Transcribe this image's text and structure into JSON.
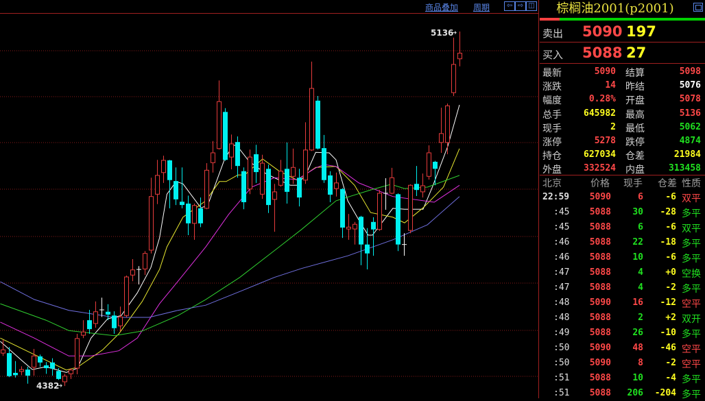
{
  "toolbar": {
    "overlay_label": "商品叠加",
    "period_label": "周期",
    "nav_left_icon": "arrow-left-icon",
    "nav_right_icon": "arrow-right-icon",
    "panel_toggle_icon": "panel-toggle-icon"
  },
  "colors": {
    "up": "#e83c3c",
    "down": "#00f0f0",
    "flat": "#ffffff",
    "grid": "#8a1a1a",
    "label_red": "#ff4848",
    "label_green": "#20e020",
    "label_yellow": "#ffff20",
    "label_white": "#ffffff"
  },
  "chart_data": {
    "type": "candlestick",
    "high_label": "5136",
    "low_label": "4382",
    "grid": true,
    "candles_ohlc": [
      [
        4452,
        4480,
        4446,
        4459
      ],
      [
        4452,
        4465,
        4401,
        4403
      ],
      [
        4410,
        4435,
        4400,
        4405
      ],
      [
        4413,
        4424,
        4405,
        4417
      ],
      [
        4417,
        4423,
        4387,
        4404
      ],
      [
        4422,
        4461,
        4404,
        4446
      ],
      [
        4445,
        4449,
        4423,
        4432
      ],
      [
        4426,
        4433,
        4408,
        4420
      ],
      [
        4432,
        4441,
        4404,
        4419
      ],
      [
        4414,
        4420,
        4395,
        4397
      ],
      [
        4391,
        4408,
        4382,
        4403
      ],
      [
        4408,
        4420,
        4397,
        4416
      ],
      [
        4420,
        4493,
        4407,
        4483
      ],
      [
        4490,
        4522,
        4484,
        4497
      ],
      [
        4522,
        4544,
        4493,
        4503
      ],
      [
        4515,
        4562,
        4506,
        4540
      ],
      [
        4544,
        4570,
        4529,
        4544
      ],
      [
        4540,
        4556,
        4522,
        4534
      ],
      [
        4532,
        4541,
        4493,
        4505
      ],
      [
        4510,
        4551,
        4499,
        4529
      ],
      [
        4532,
        4617,
        4528,
        4614
      ],
      [
        4618,
        4652,
        4605,
        4629
      ],
      [
        4630,
        4637,
        4598,
        4630
      ],
      [
        4631,
        4669,
        4618,
        4664
      ],
      [
        4671,
        4825,
        4664,
        4785
      ],
      [
        4790,
        4863,
        4769,
        4830
      ],
      [
        4836,
        4872,
        4814,
        4862
      ],
      [
        4862,
        4863,
        4760,
        4820
      ],
      [
        4818,
        4847,
        4767,
        4779
      ],
      [
        4774,
        4847,
        4760,
        4767
      ],
      [
        4770,
        4787,
        4703,
        4728
      ],
      [
        4728,
        4770,
        4693,
        4766
      ],
      [
        4760,
        4783,
        4720,
        4728
      ],
      [
        4760,
        4856,
        4758,
        4841
      ],
      [
        4857,
        4903,
        4836,
        4878
      ],
      [
        4887,
        5032,
        4885,
        4987
      ],
      [
        4965,
        4973,
        4861,
        4863
      ],
      [
        4869,
        4917,
        4843,
        4897
      ],
      [
        4901,
        4913,
        4825,
        4850
      ],
      [
        4839,
        4847,
        4758,
        4773
      ],
      [
        4801,
        4885,
        4790,
        4869
      ],
      [
        4875,
        4895,
        4814,
        4837
      ],
      [
        4790,
        4874,
        4780,
        4856
      ],
      [
        4844,
        4853,
        4750,
        4767
      ],
      [
        4779,
        4812,
        4710,
        4795
      ],
      [
        4809,
        4863,
        4806,
        4839
      ],
      [
        4844,
        4900,
        4770,
        4795
      ],
      [
        4828,
        4887,
        4812,
        4847
      ],
      [
        4825,
        4844,
        4764,
        4783
      ],
      [
        4820,
        4943,
        4812,
        4884
      ],
      [
        4884,
        5072,
        4882,
        5015
      ],
      [
        4989,
        4999,
        4885,
        4887
      ],
      [
        4888,
        4916,
        4814,
        4820
      ],
      [
        4830,
        4839,
        4773,
        4789
      ],
      [
        4802,
        4836,
        4785,
        4814
      ],
      [
        4801,
        4803,
        4697,
        4719
      ],
      [
        4716,
        4748,
        4693,
        4720
      ],
      [
        4716,
        4731,
        4683,
        4726
      ],
      [
        4742,
        4744,
        4639,
        4683
      ],
      [
        4683,
        4718,
        4630,
        4664
      ],
      [
        4731,
        4741,
        4659,
        4715
      ],
      [
        4715,
        4799,
        4712,
        4792
      ],
      [
        4792,
        4824,
        4757,
        4792
      ],
      [
        4792,
        4846,
        4790,
        4825
      ],
      [
        4790,
        4792,
        4669,
        4683
      ],
      [
        4683,
        4707,
        4659,
        4683
      ],
      [
        4713,
        4811,
        4707,
        4809
      ],
      [
        4812,
        4850,
        4786,
        4799
      ],
      [
        4795,
        4834,
        4783,
        4808
      ],
      [
        4828,
        4894,
        4821,
        4878
      ],
      [
        4859,
        4861,
        4809,
        4844
      ],
      [
        4900,
        4974,
        4878,
        4919
      ],
      [
        4900,
        4983,
        4875,
        4978
      ],
      [
        5006,
        5123,
        4999,
        5066
      ],
      [
        5078,
        5136,
        5062,
        5090
      ]
    ],
    "moving_averages": [
      {
        "color": "#ffffff",
        "points": [
          [
            -0.4,
            4477
          ],
          [
            3.2,
            4435
          ],
          [
            4.8,
            4417
          ],
          [
            7,
            4423
          ],
          [
            10.3,
            4411
          ],
          [
            12.1,
            4420
          ],
          [
            14.3,
            4484
          ],
          [
            17,
            4525
          ],
          [
            19.2,
            4532
          ],
          [
            21.8,
            4580
          ],
          [
            24,
            4634
          ],
          [
            25.4,
            4697
          ],
          [
            26.6,
            4790
          ],
          [
            28.1,
            4817
          ],
          [
            29.2,
            4812
          ],
          [
            32.1,
            4761
          ],
          [
            33.2,
            4766
          ],
          [
            35.9,
            4863
          ],
          [
            37.3,
            4894
          ],
          [
            37.9,
            4894
          ],
          [
            39.9,
            4860
          ],
          [
            42.6,
            4834
          ],
          [
            44,
            4825
          ],
          [
            46.6,
            4809
          ],
          [
            47.7,
            4809
          ],
          [
            49.2,
            4834
          ],
          [
            50.7,
            4879
          ],
          [
            52.9,
            4878
          ],
          [
            54,
            4863
          ],
          [
            55.9,
            4776
          ],
          [
            58.1,
            4726
          ],
          [
            59.2,
            4703
          ],
          [
            59.9,
            4703
          ],
          [
            62.1,
            4741
          ],
          [
            63.2,
            4760
          ],
          [
            65.1,
            4758
          ],
          [
            68.1,
            4758
          ],
          [
            69.6,
            4805
          ],
          [
            72.1,
            4892
          ],
          [
            74,
            4980
          ]
        ]
      },
      {
        "color": "#e8e830",
        "points": [
          [
            -0.4,
            4484
          ],
          [
            5.1,
            4449
          ],
          [
            10.3,
            4416
          ],
          [
            12.1,
            4422
          ],
          [
            16.2,
            4459
          ],
          [
            18.8,
            4493
          ],
          [
            22.6,
            4562
          ],
          [
            25.4,
            4630
          ],
          [
            26.6,
            4678
          ],
          [
            29.2,
            4741
          ],
          [
            32.9,
            4776
          ],
          [
            35.1,
            4817
          ],
          [
            36.2,
            4817
          ],
          [
            38.1,
            4831
          ],
          [
            39.2,
            4831
          ],
          [
            42.1,
            4865
          ],
          [
            44.8,
            4839
          ],
          [
            47.7,
            4820
          ],
          [
            50.7,
            4847
          ],
          [
            54,
            4849
          ],
          [
            57,
            4809
          ],
          [
            59.6,
            4751
          ],
          [
            63.2,
            4741
          ],
          [
            65.1,
            4729
          ],
          [
            68.1,
            4761
          ],
          [
            71.4,
            4805
          ],
          [
            74,
            4887
          ]
        ]
      },
      {
        "color": "#e030e0",
        "points": [
          [
            -0.4,
            4518
          ],
          [
            5.1,
            4484
          ],
          [
            10.7,
            4446
          ],
          [
            14.3,
            4446
          ],
          [
            18.8,
            4457
          ],
          [
            21.8,
            4484
          ],
          [
            25.4,
            4557
          ],
          [
            28.4,
            4605
          ],
          [
            32.9,
            4678
          ],
          [
            36.6,
            4747
          ],
          [
            40.3,
            4805
          ],
          [
            44,
            4825
          ],
          [
            47.7,
            4821
          ],
          [
            50.7,
            4846
          ],
          [
            52.1,
            4853
          ],
          [
            54,
            4849
          ],
          [
            57.7,
            4814
          ],
          [
            63.2,
            4785
          ],
          [
            69.9,
            4773
          ],
          [
            74,
            4809
          ]
        ]
      },
      {
        "color": "#30d030",
        "points": [
          [
            -0.4,
            4557
          ],
          [
            7,
            4522
          ],
          [
            10.7,
            4500
          ],
          [
            18.1,
            4489
          ],
          [
            22.6,
            4499
          ],
          [
            28.4,
            4532
          ],
          [
            32.9,
            4566
          ],
          [
            38.4,
            4613
          ],
          [
            44.8,
            4678
          ],
          [
            48.4,
            4715
          ],
          [
            54,
            4776
          ],
          [
            59.6,
            4799
          ],
          [
            62.9,
            4811
          ],
          [
            65.1,
            4802
          ],
          [
            68.8,
            4805
          ],
          [
            74,
            4830
          ]
        ]
      },
      {
        "color": "#7070e0",
        "points": [
          [
            -0.4,
            4604
          ],
          [
            5.1,
            4566
          ],
          [
            10.7,
            4543
          ],
          [
            18.1,
            4528
          ],
          [
            23.7,
            4528
          ],
          [
            28.4,
            4543
          ],
          [
            32.9,
            4554
          ],
          [
            38.4,
            4583
          ],
          [
            44,
            4613
          ],
          [
            48.4,
            4632
          ],
          [
            55.9,
            4659
          ],
          [
            63.2,
            4693
          ],
          [
            68.8,
            4725
          ],
          [
            74,
            4785
          ]
        ]
      }
    ]
  },
  "quote": {
    "title": "棕榈油2001(p2001)",
    "buy_ratio": 0.12,
    "ask": {
      "label": "卖出",
      "price": "5090",
      "volume": "197"
    },
    "bid": {
      "label": "买入",
      "price": "5088",
      "volume": "27"
    },
    "rows": [
      {
        "l1": "最新",
        "v1": "5090",
        "c1": "#ff4848",
        "l2": "结算",
        "v2": "5098",
        "c2": "#ff4848"
      },
      {
        "l1": "涨跌",
        "v1": "14",
        "c1": "#ff4848",
        "l2": "昨结",
        "v2": "5076",
        "c2": "#ffffff"
      },
      {
        "l1": "幅度",
        "v1": "0.28%",
        "c1": "#ff4848",
        "l2": "开盘",
        "v2": "5078",
        "c2": "#ff4848"
      },
      {
        "l1": "总手",
        "v1": "645982",
        "c1": "#ffff20",
        "l2": "最高",
        "v2": "5136",
        "c2": "#ff4848"
      },
      {
        "l1": "现手",
        "v1": "2",
        "c1": "#ffff20",
        "l2": "最低",
        "v2": "5062",
        "c2": "#20e020"
      },
      {
        "l1": "涨停",
        "v1": "5278",
        "c1": "#ff4848",
        "l2": "跌停",
        "v2": "4874",
        "c2": "#20e020"
      },
      {
        "l1": "持仓",
        "v1": "627034",
        "c1": "#ffff20",
        "l2": "仓差",
        "v2": "21984",
        "c2": "#ffff20"
      },
      {
        "l1": "外盘",
        "v1": "332524",
        "c1": "#ff4848",
        "l2": "内盘",
        "v2": "313458",
        "c2": "#20e020"
      }
    ]
  },
  "ticks": {
    "headers": [
      "北京",
      "价格",
      "现手",
      "仓差",
      "性质"
    ],
    "rows": [
      {
        "time": "22:59",
        "price": "5090",
        "qty": "6",
        "qty_color": "#ff4848",
        "diff": "-6",
        "nature": "双平",
        "nature_color": "#ff4848"
      },
      {
        "time": ":45",
        "price": "5088",
        "qty": "30",
        "qty_color": "#20e020",
        "diff": "-28",
        "nature": "多平",
        "nature_color": "#20e020"
      },
      {
        "time": ":45",
        "price": "5088",
        "qty": "6",
        "qty_color": "#20e020",
        "diff": "-6",
        "nature": "双平",
        "nature_color": "#20e020"
      },
      {
        "time": ":46",
        "price": "5088",
        "qty": "22",
        "qty_color": "#20e020",
        "diff": "-18",
        "nature": "多平",
        "nature_color": "#20e020"
      },
      {
        "time": ":46",
        "price": "5088",
        "qty": "10",
        "qty_color": "#20e020",
        "diff": "-6",
        "nature": "多平",
        "nature_color": "#20e020"
      },
      {
        "time": ":47",
        "price": "5088",
        "qty": "4",
        "qty_color": "#20e020",
        "diff": "+0",
        "nature": "空换",
        "nature_color": "#20e020"
      },
      {
        "time": ":47",
        "price": "5088",
        "qty": "4",
        "qty_color": "#20e020",
        "diff": "-2",
        "nature": "多平",
        "nature_color": "#20e020"
      },
      {
        "time": ":48",
        "price": "5090",
        "qty": "16",
        "qty_color": "#ff4848",
        "diff": "-12",
        "nature": "空平",
        "nature_color": "#ff4848"
      },
      {
        "time": ":48",
        "price": "5088",
        "qty": "2",
        "qty_color": "#20e020",
        "diff": "+2",
        "nature": "双开",
        "nature_color": "#20e020"
      },
      {
        "time": ":49",
        "price": "5088",
        "qty": "26",
        "qty_color": "#20e020",
        "diff": "-10",
        "nature": "多平",
        "nature_color": "#20e020"
      },
      {
        "time": ":50",
        "price": "5090",
        "qty": "48",
        "qty_color": "#ff4848",
        "diff": "-46",
        "nature": "空平",
        "nature_color": "#ff4848"
      },
      {
        "time": ":50",
        "price": "5090",
        "qty": "8",
        "qty_color": "#ff4848",
        "diff": "-2",
        "nature": "空平",
        "nature_color": "#ff4848"
      },
      {
        "time": ":51",
        "price": "5088",
        "qty": "10",
        "qty_color": "#20e020",
        "diff": "-4",
        "nature": "多平",
        "nature_color": "#20e020"
      },
      {
        "time": ":51",
        "price": "5088",
        "qty": "206",
        "qty_color": "#20e020",
        "diff": "-204",
        "nature": "多平",
        "nature_color": "#20e020"
      }
    ]
  }
}
